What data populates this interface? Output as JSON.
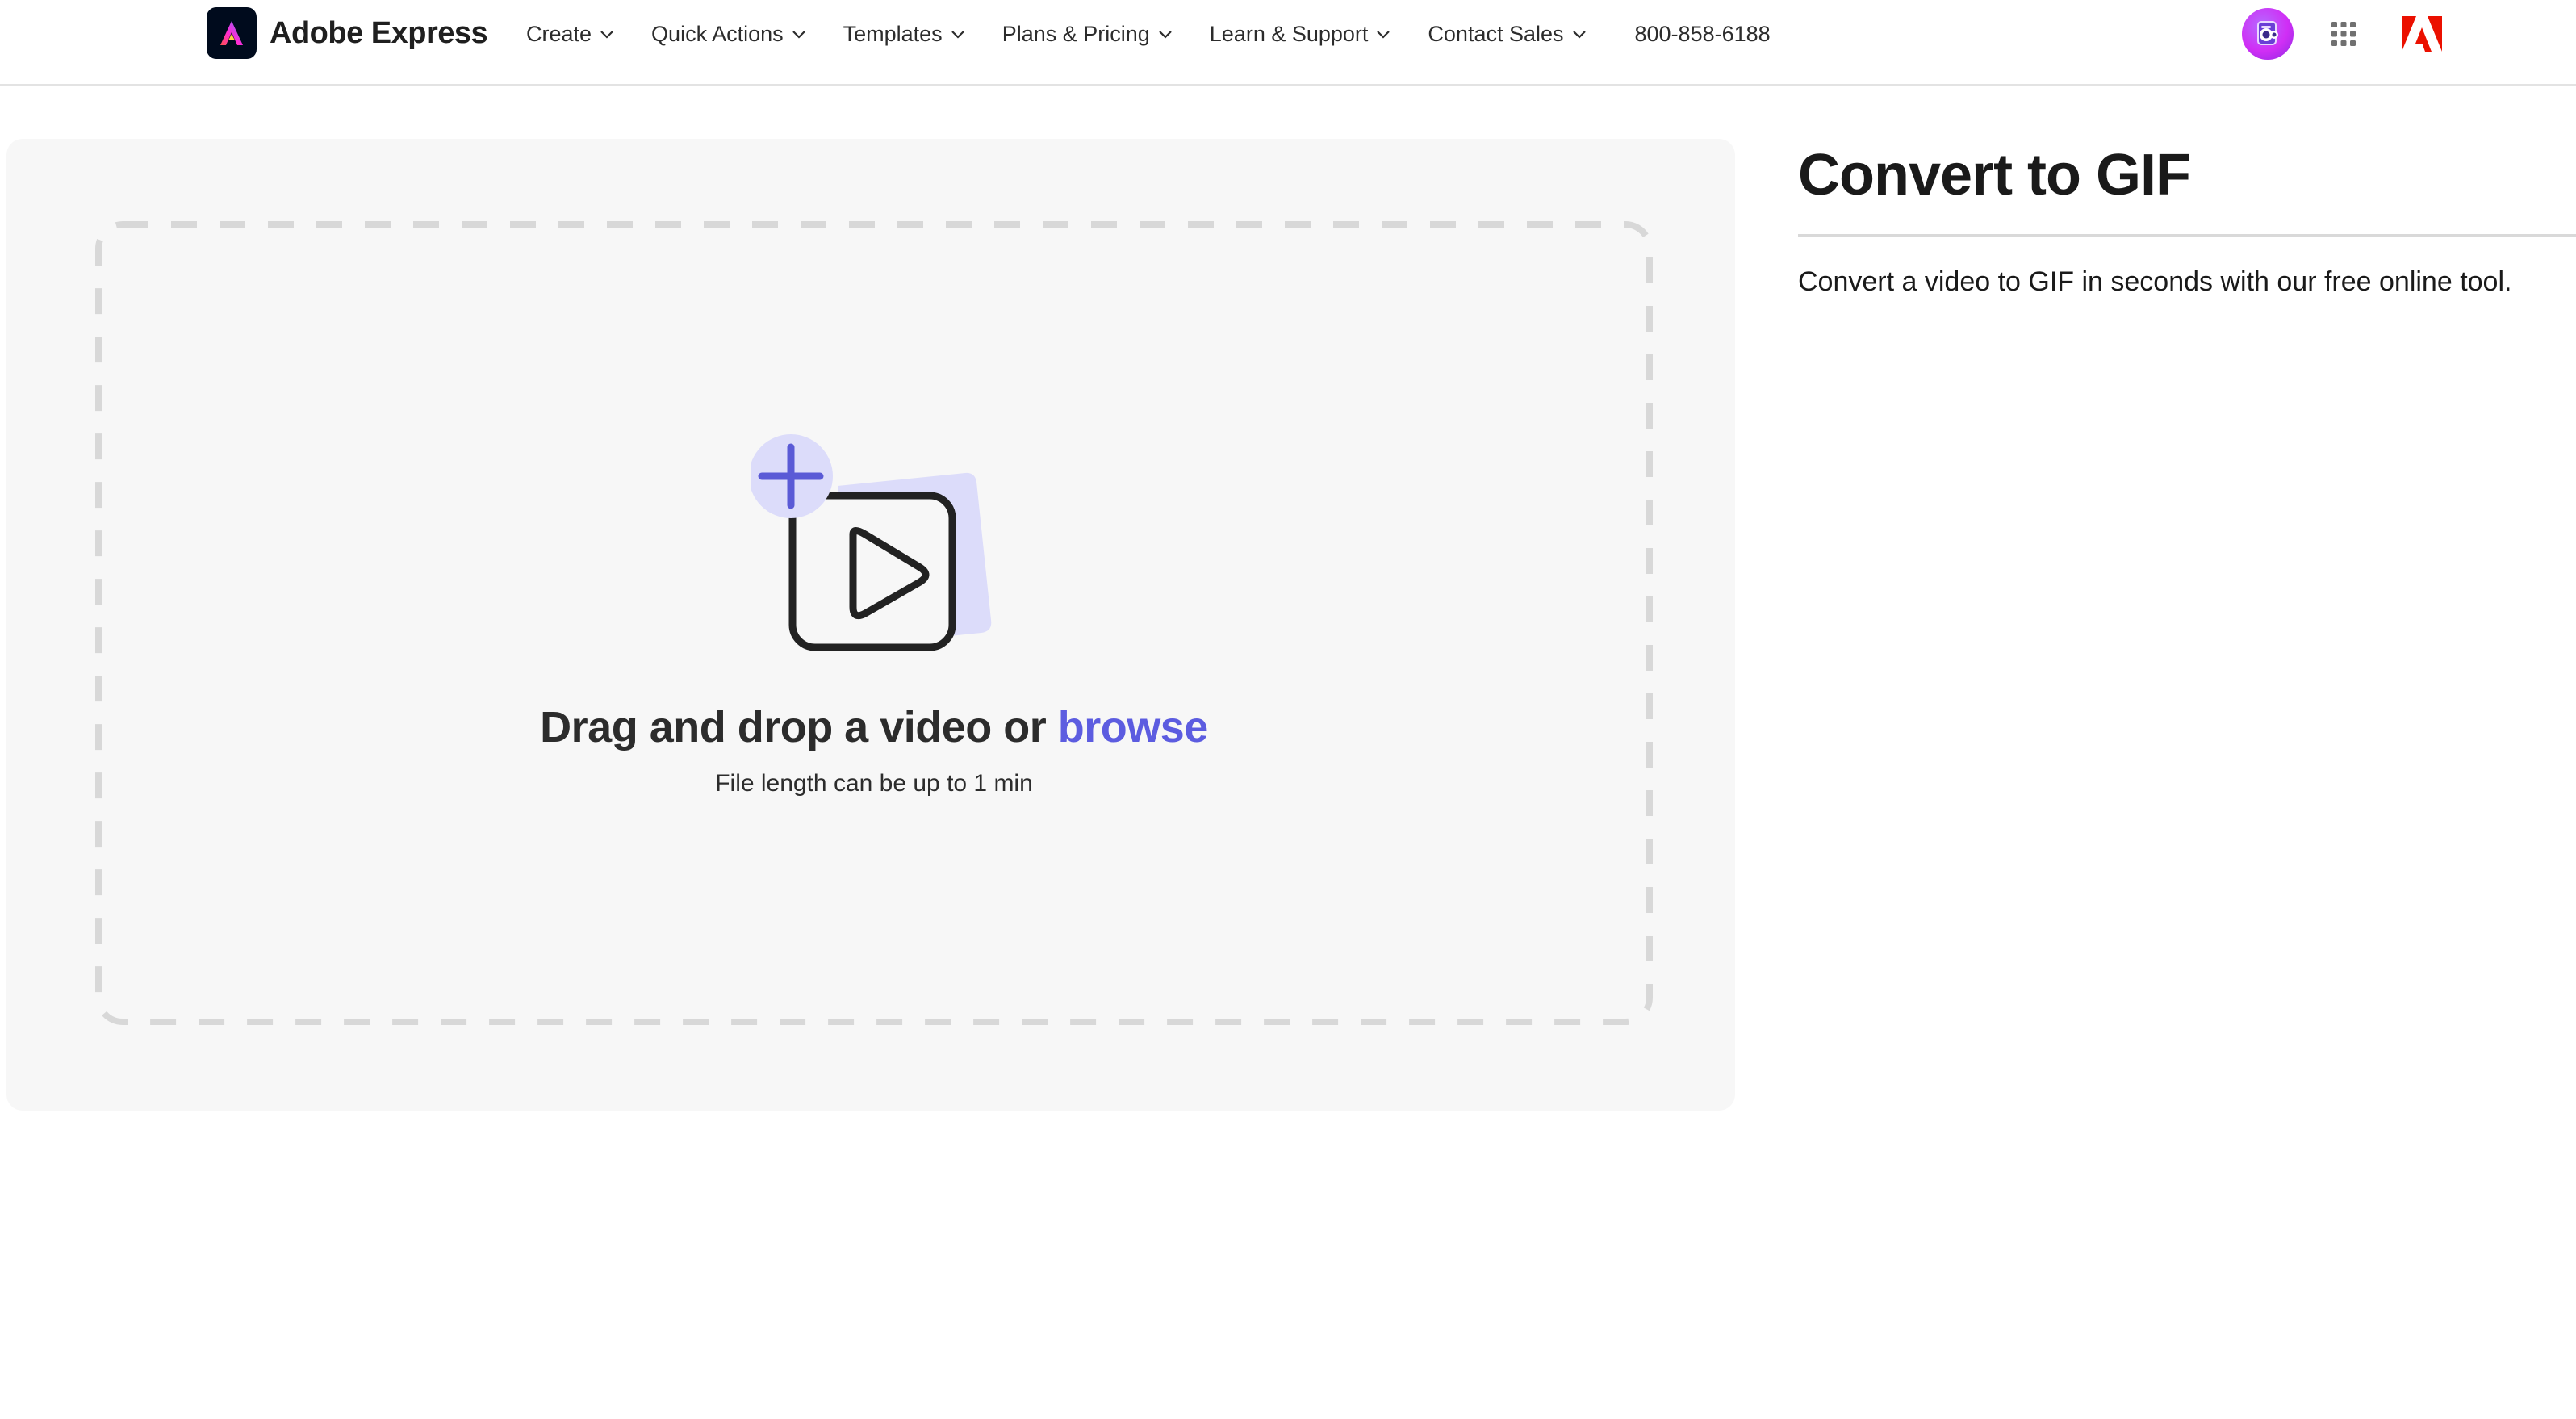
{
  "header": {
    "brand_name": "Adobe Express",
    "menu": [
      {
        "label": "Create"
      },
      {
        "label": "Quick Actions"
      },
      {
        "label": "Templates"
      },
      {
        "label": "Plans & Pricing"
      },
      {
        "label": "Learn & Support"
      },
      {
        "label": "Contact Sales"
      }
    ],
    "phone": "800-858-6188"
  },
  "upload": {
    "title_prefix": "Drag and drop a video or ",
    "browse_label": "browse",
    "subtitle": "File length can be up to 1 min"
  },
  "main": {
    "title": "Convert to GIF",
    "description": "Convert a video to GIF in seconds with our free online tool."
  },
  "colors": {
    "accent": "#5c5ce0",
    "panel_bg": "#f7f7f7",
    "dash_border": "#d8d8d8",
    "adobe_red": "#eb1000"
  },
  "icons": [
    "adobe-express-logo-icon",
    "chevron-down-icon",
    "avatar-icon",
    "app-switcher-icon",
    "adobe-logo-icon",
    "add-video-icon",
    "play-icon",
    "plus-icon"
  ]
}
